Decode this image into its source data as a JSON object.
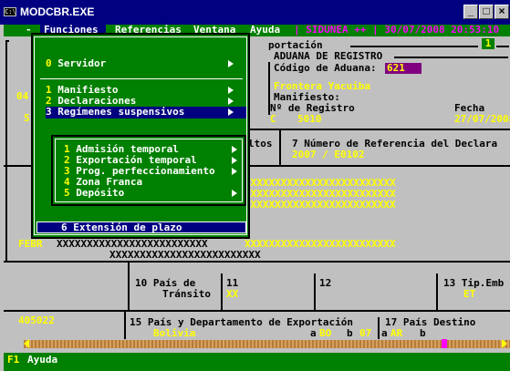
{
  "window": {
    "title": "MODCBR.EXE",
    "min": "_",
    "max": "□",
    "close": "×"
  },
  "menubar": {
    "dash": "-",
    "items": [
      "Funciones",
      "Referencias",
      "Ventana",
      "Ayuda"
    ],
    "status": "| SIDUNEA ++ | 30/07/2008 20:53:10"
  },
  "funciones_menu": {
    "items": [
      {
        "num": "0",
        "label": "Servidor"
      },
      {
        "num": "1",
        "label": "Manifiesto"
      },
      {
        "num": "2",
        "label": "Declaraciones"
      },
      {
        "num": "3",
        "label": "Regímenes suspensivos"
      },
      {
        "num": "6",
        "label": "Extensión de plazo"
      }
    ]
  },
  "regimenes_menu": {
    "items": [
      {
        "num": "1",
        "label": "Admisión temporal"
      },
      {
        "num": "2",
        "label": "Exportación temporal"
      },
      {
        "num": "3",
        "label": "Prog. perfeccionamiento"
      },
      {
        "num": "4",
        "label": "Zona Franca"
      },
      {
        "num": "5",
        "label": "Depósito"
      }
    ]
  },
  "form": {
    "header_tail": "portación",
    "header_num": "1",
    "aduana_title": "ADUANA DE REGISTRO",
    "codigo_label": "Código de Aduana:",
    "codigo_value": "621",
    "aduana_name": "Frontera Yacuiba",
    "manifiesto_label": "Manifiesto:",
    "registro_label": "Nº de Registro",
    "registro_prefix": "C",
    "registro_value": "5010",
    "fecha_label": "Fecha",
    "fecha_value": "27/07/2008",
    "bultos_tail": "ltos",
    "ref_label": "7 Número de Referencia del Declara",
    "ref_value": "2007 / E0102",
    "xfill": "XXXXXXXXXXXXXXXXXXXXXXXXX",
    "pais_label_1": "10 País de",
    "pais_label_2": "Tránsito",
    "f11_label": "11",
    "f11_value": "XX",
    "f12_label": "12",
    "f13_label": "13 Tip.Emb",
    "f13_value": "ET",
    "f15_label": "15 País y Departamento de Exportación",
    "f15_value": "Bolivia",
    "f15_a": "a",
    "f15_a_value": "BO",
    "f15_b": "b",
    "f15_b_value": "07",
    "f17_label": "17 País Destino",
    "f17_a": "a",
    "f17_a_value": "AR",
    "f17_b": "b",
    "left_04": "04",
    "left_s": "S",
    "left_febr": "FEBR",
    "left_405022": "405022"
  },
  "statusbar": {
    "key": "F1",
    "label": "Ayuda"
  }
}
